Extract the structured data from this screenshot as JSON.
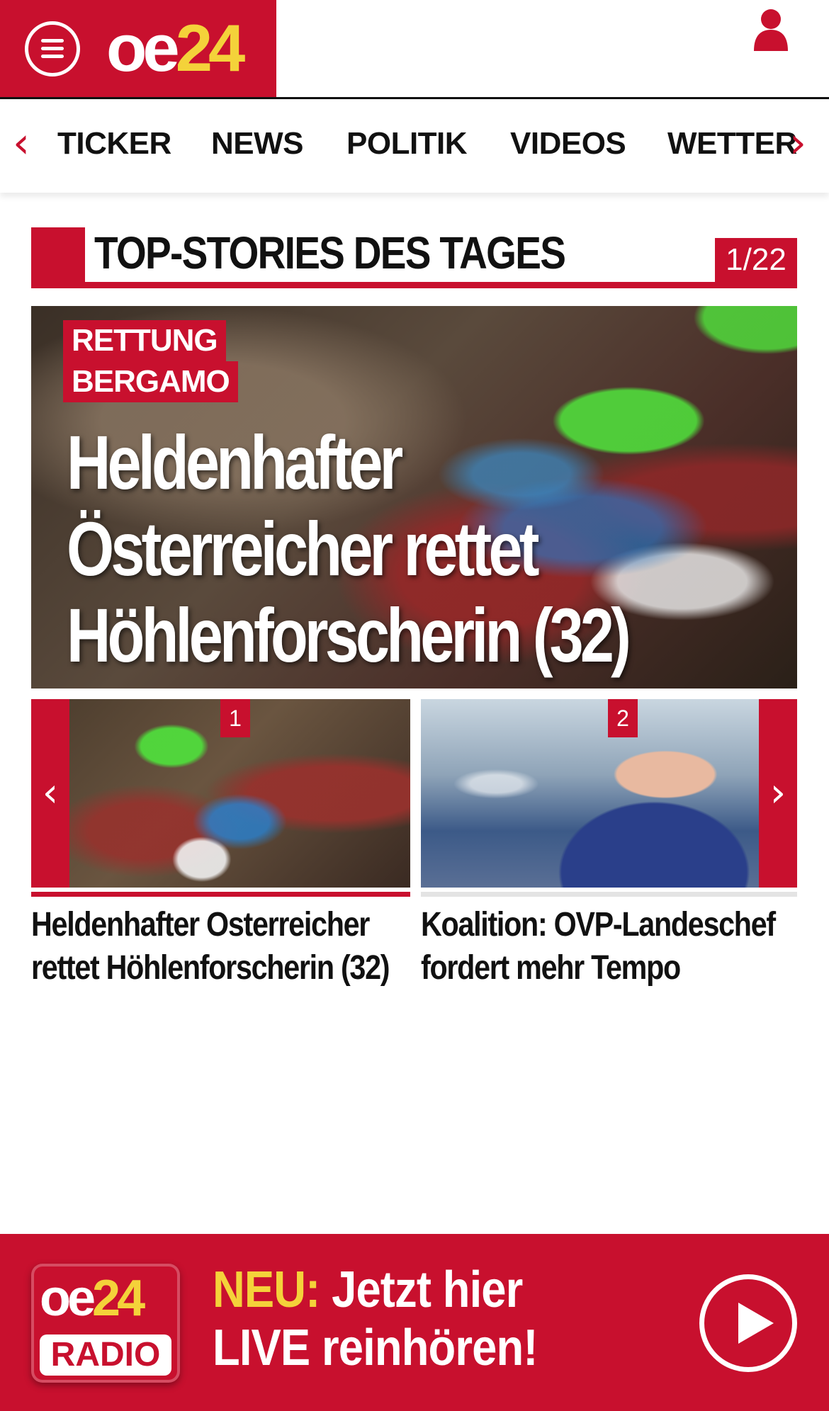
{
  "header": {
    "logo_part1": "oe",
    "logo_part2": "24",
    "menu_icon": "hamburger-menu-icon",
    "user_icon": "user-icon"
  },
  "nav": {
    "items": [
      "TICKER",
      "NEWS",
      "POLITIK",
      "VIDEOS",
      "WETTER"
    ],
    "prev_icon": "‹",
    "next_icon": "›"
  },
  "section": {
    "title": "TOP-STORIES DES TAGES",
    "counter": "1/22"
  },
  "hero": {
    "tag_line1": "RETTUNG",
    "tag_line2": "BERGAMO",
    "headline": "Heldenhafter Österreicher rettet Höhlenforscherin (32)"
  },
  "carousel": {
    "prev_label": "‹",
    "next_label": "›",
    "items": [
      {
        "number": "1",
        "title": "Heldenhafter Osterreicher rettet Höhlenforscherin (32)"
      },
      {
        "number": "2",
        "title": "Koalition: OVP-Landeschef fordert mehr Tempo"
      }
    ]
  },
  "radio": {
    "logo_part1": "oe",
    "logo_part2": "24",
    "logo_sub": "RADIO",
    "prefix": "NEU:",
    "line1": " Jetzt hier",
    "line2": "LIVE reinhören!",
    "play_icon": "play-icon"
  },
  "colors": {
    "brand_red": "#c8102e",
    "brand_yellow": "#f4d23a"
  }
}
